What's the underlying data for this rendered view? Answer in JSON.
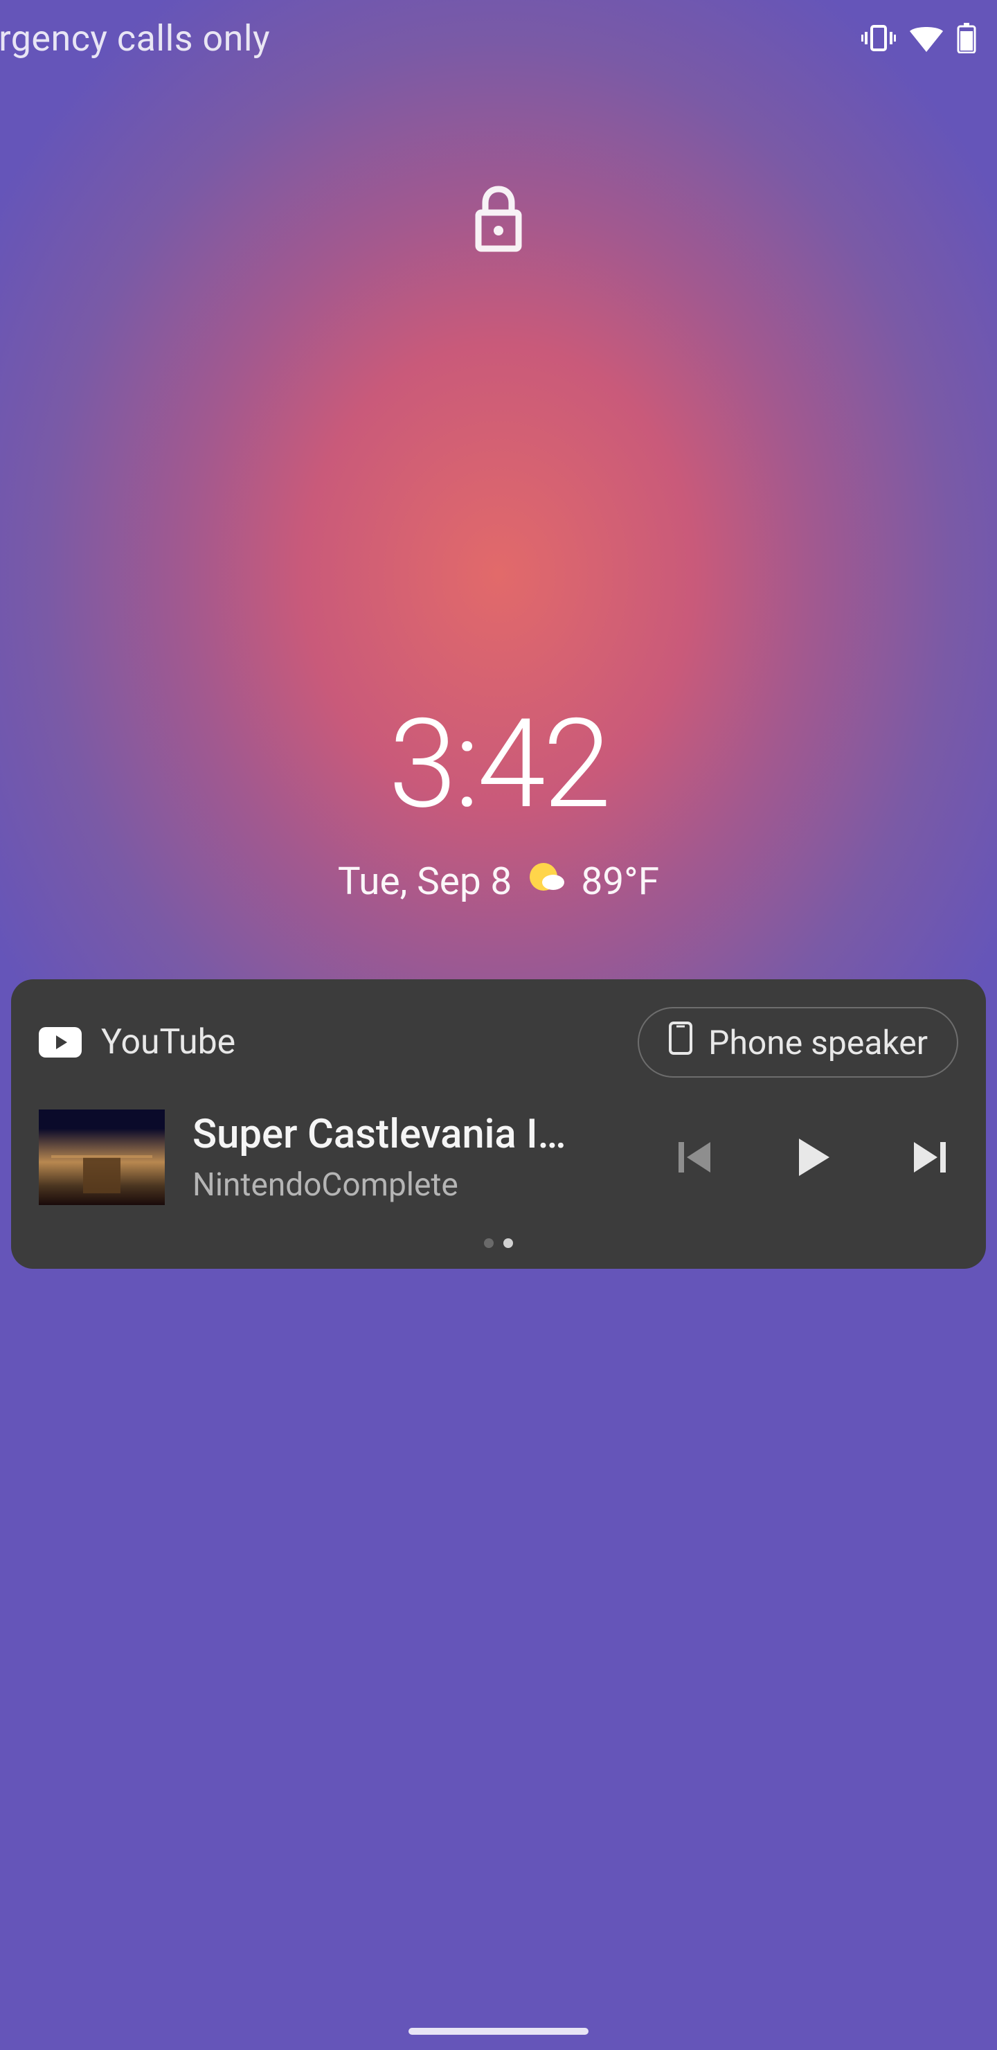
{
  "status_bar": {
    "network_text": "ergency calls only",
    "icons": [
      "vibrate-icon",
      "wifi-icon",
      "battery-icon"
    ]
  },
  "lock": {
    "state": "locked"
  },
  "clock": {
    "time": "3:42",
    "date": "Tue, Sep 8",
    "weather_temp": "89°F",
    "weather_icon": "partly-cloudy-icon"
  },
  "media": {
    "app_name": "YouTube",
    "output_label": "Phone speaker",
    "title": "Super Castlevania I…",
    "channel": "NintendoComplete",
    "controls": {
      "prev": "previous",
      "play": "play",
      "next": "next"
    },
    "pager_count": 2,
    "pager_active_index": 1
  }
}
